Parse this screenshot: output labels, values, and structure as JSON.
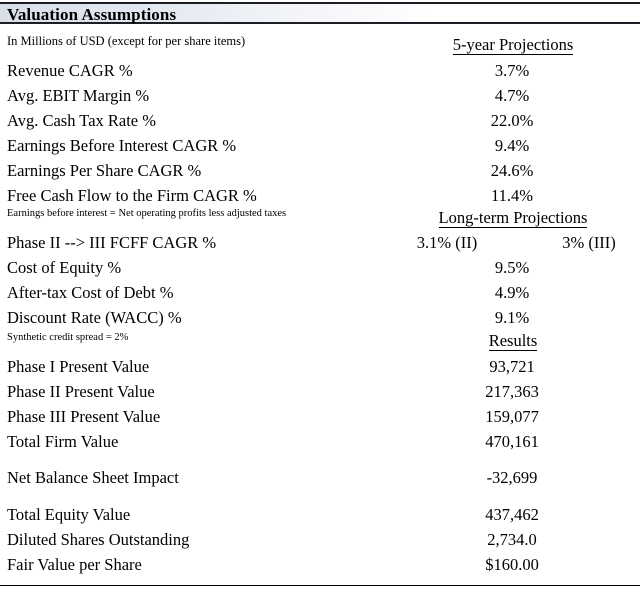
{
  "header": {
    "title": "Valuation Assumptions",
    "subtitle": "In Millions of USD (except for per share items)"
  },
  "sections": {
    "five_year": {
      "heading": "5-year Projections",
      "rows": [
        {
          "label": "Revenue CAGR %",
          "value": "3.7%"
        },
        {
          "label": "Avg. EBIT Margin %",
          "value": "4.7%"
        },
        {
          "label": "Avg. Cash Tax Rate %",
          "value": "22.0%"
        },
        {
          "label": "Earnings Before Interest CAGR %",
          "value": "9.4%"
        },
        {
          "label": "Earnings Per Share CAGR %",
          "value": "24.6%"
        },
        {
          "label": "Free Cash Flow to the Firm CAGR %",
          "value": "11.4%"
        }
      ]
    },
    "long_term": {
      "heading": "Long-term Projections",
      "rows": [
        {
          "label": "Phase II --> III FCFF CAGR %",
          "value_left": "3.1% (II)",
          "value_right": "3% (III)"
        },
        {
          "label": "Cost of Equity %",
          "value": "9.5%"
        },
        {
          "label": "After-tax Cost of Debt %",
          "value": "4.9%"
        },
        {
          "label": "Discount Rate (WACC) %",
          "value": "9.1%"
        }
      ]
    },
    "results": {
      "heading": "Results",
      "rows": [
        {
          "label": "Phase I Present Value",
          "value": "93,721"
        },
        {
          "label": "Phase II Present Value",
          "value": "217,363"
        },
        {
          "label": "Phase III Present Value",
          "value": "159,077"
        },
        {
          "label": "Total Firm Value",
          "value": "470,161"
        },
        {
          "label": "Net Balance Sheet Impact",
          "value": "-32,699"
        },
        {
          "label": "Total Equity Value",
          "value": "437,462"
        },
        {
          "label": "Diluted Shares Outstanding",
          "value": "2,734.0"
        },
        {
          "label": "Fair Value per Share",
          "value": "$160.00"
        }
      ]
    }
  },
  "notes": {
    "ebi_definition": "Earnings before interest = Net operating profits less adjusted taxes",
    "credit_spread": "Synthetic credit spread = 2%"
  }
}
